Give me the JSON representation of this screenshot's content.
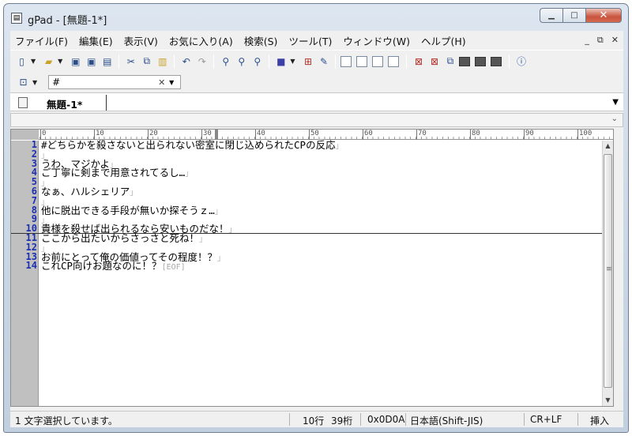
{
  "window": {
    "title": "gPad - [無題-1*]"
  },
  "menu": {
    "items": [
      "ファイル(F)",
      "編集(E)",
      "表示(V)",
      "お気に入り(A)",
      "検索(S)",
      "ツール(T)",
      "ウィンドウ(W)",
      "ヘルプ(H)"
    ]
  },
  "search": {
    "value": "#"
  },
  "tab": {
    "label": "無題-1*"
  },
  "ruler": {
    "labels": [
      "0",
      "10",
      "20",
      "30",
      "40",
      "50",
      "60",
      "70",
      "80",
      "90",
      "100"
    ]
  },
  "editor": {
    "current_line": 10,
    "lines": [
      {
        "n": "1",
        "text": "#どちらかを殺さないと出られない密室に閉じ込められたCPの反応"
      },
      {
        "n": "2",
        "text": ""
      },
      {
        "n": "3",
        "text": "うわ、マジかよ"
      },
      {
        "n": "4",
        "text": "ご丁寧に剣まで用意されてるし…"
      },
      {
        "n": "5",
        "text": ""
      },
      {
        "n": "6",
        "text": "なぁ、ハルシェリア"
      },
      {
        "n": "7",
        "text": ""
      },
      {
        "n": "8",
        "text": "他に脱出できる手段が無いか探そうｚ…"
      },
      {
        "n": "9",
        "text": ""
      },
      {
        "n": "10",
        "text": "貴様を殺せば出られるなら安いものだな！"
      },
      {
        "n": "11",
        "text": "ここから出たいからさっさと死ね！"
      },
      {
        "n": "12",
        "text": ""
      },
      {
        "n": "13",
        "text": "お前にとって俺の価値ってその程度！？"
      },
      {
        "n": "14",
        "text": "これCP向けお題なのに！？"
      }
    ],
    "eol_mark": "」",
    "eof_mark": "[EOF]"
  },
  "status": {
    "message": "1 文字選択しています。",
    "line": "10行",
    "column": "39桁",
    "code": "0x0D0A",
    "encoding": "日本語(Shift-JIS)",
    "newline": "CR+LF",
    "mode": "挿入"
  }
}
